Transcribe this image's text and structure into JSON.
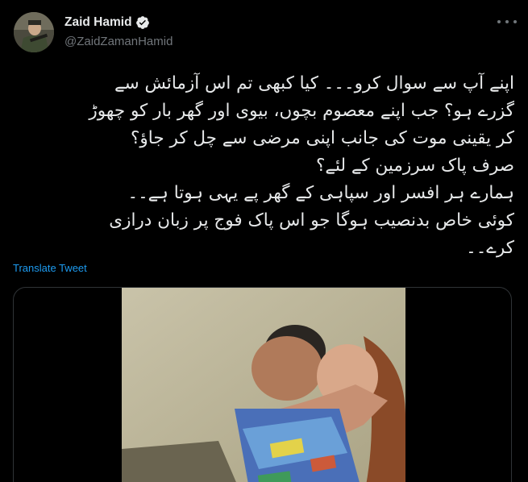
{
  "author": {
    "display_name": "Zaid Hamid",
    "handle": "@ZaidZamanHamid",
    "verified_icon": "verified-badge-icon",
    "avatar_icon": "avatar"
  },
  "tweet": {
    "lines": [
      "اپنے آپ سے سوال کرو۔۔۔ کیا کبھی تم اس آزمائش سے",
      "گزرے ہو؟ جب اپنے معصوم بچوں، بیوی اور گھر بار کو چھوڑ",
      "کر یقینی موت کی جانب اپنی مرضی سے چل کر جاؤ؟",
      "صرف پاک سرزمین کے لئے؟",
      "ہمارے ہر افسر اور سپاہی کے گھر پے یہی ہوتا ہے۔۔",
      "کوئی خاص بدنصیب ہوگا جو اس پاک فوج پر زبان درازی",
      "کرے۔۔"
    ],
    "translate_label": "Translate Tweet"
  },
  "colors": {
    "background": "#000000",
    "text": "#e7e9ea",
    "muted": "#71767b",
    "accent": "#1d9bf0",
    "border": "#2f3336"
  }
}
